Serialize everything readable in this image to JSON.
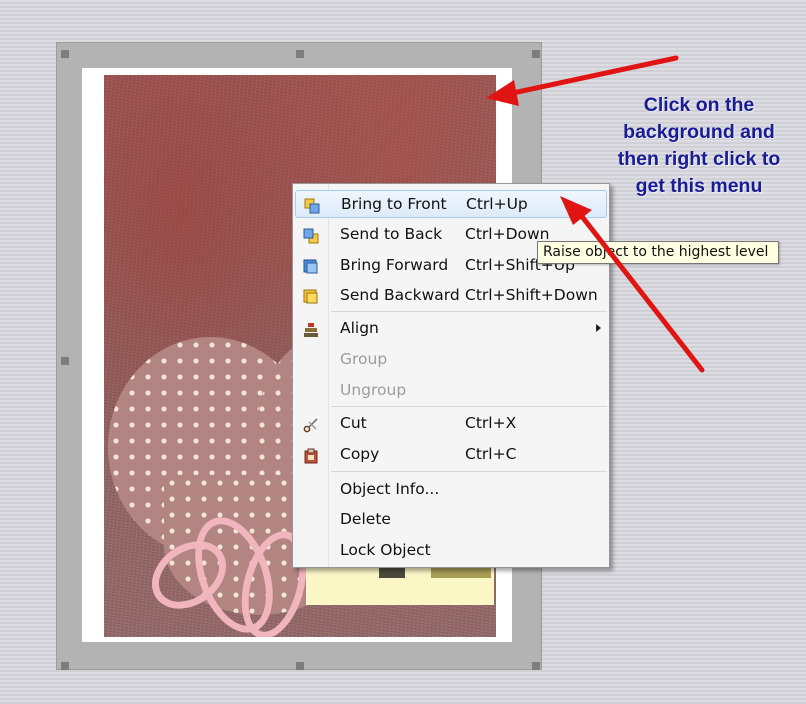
{
  "annotation": {
    "callout_lines": [
      "Click on the",
      "background and",
      "then right click to",
      "get this menu"
    ]
  },
  "context_menu": {
    "groups": [
      [
        {
          "label": "Bring to Front",
          "shortcut": "Ctrl+Up",
          "icon": "bring-to-front-icon",
          "highlighted": true
        },
        {
          "label": "Send to Back",
          "shortcut": "Ctrl+Down",
          "icon": "send-to-back-icon"
        },
        {
          "label": "Bring Forward",
          "shortcut": "Ctrl+Shift+Up",
          "icon": "bring-forward-icon"
        },
        {
          "label": "Send Backward",
          "shortcut": "Ctrl+Shift+Down",
          "icon": "send-backward-icon"
        }
      ],
      [
        {
          "label": "Align",
          "shortcut": "",
          "icon": "align-icon",
          "submenu": true
        },
        {
          "label": "Group",
          "shortcut": "",
          "disabled": true
        },
        {
          "label": "Ungroup",
          "shortcut": "",
          "disabled": true
        }
      ],
      [
        {
          "label": "Cut",
          "shortcut": "Ctrl+X",
          "icon": "scissors-icon"
        },
        {
          "label": "Copy",
          "shortcut": "Ctrl+C",
          "icon": "copy-icon"
        }
      ],
      [
        {
          "label": "Object Info...",
          "shortcut": ""
        },
        {
          "label": "Delete",
          "shortcut": ""
        },
        {
          "label": "Lock Object",
          "shortcut": ""
        }
      ]
    ]
  },
  "tooltip": {
    "text": "Raise object to the highest level"
  },
  "colors": {
    "arrow": "#e11414",
    "callout_text": "#181c95",
    "highlight": "#dceaf9"
  }
}
